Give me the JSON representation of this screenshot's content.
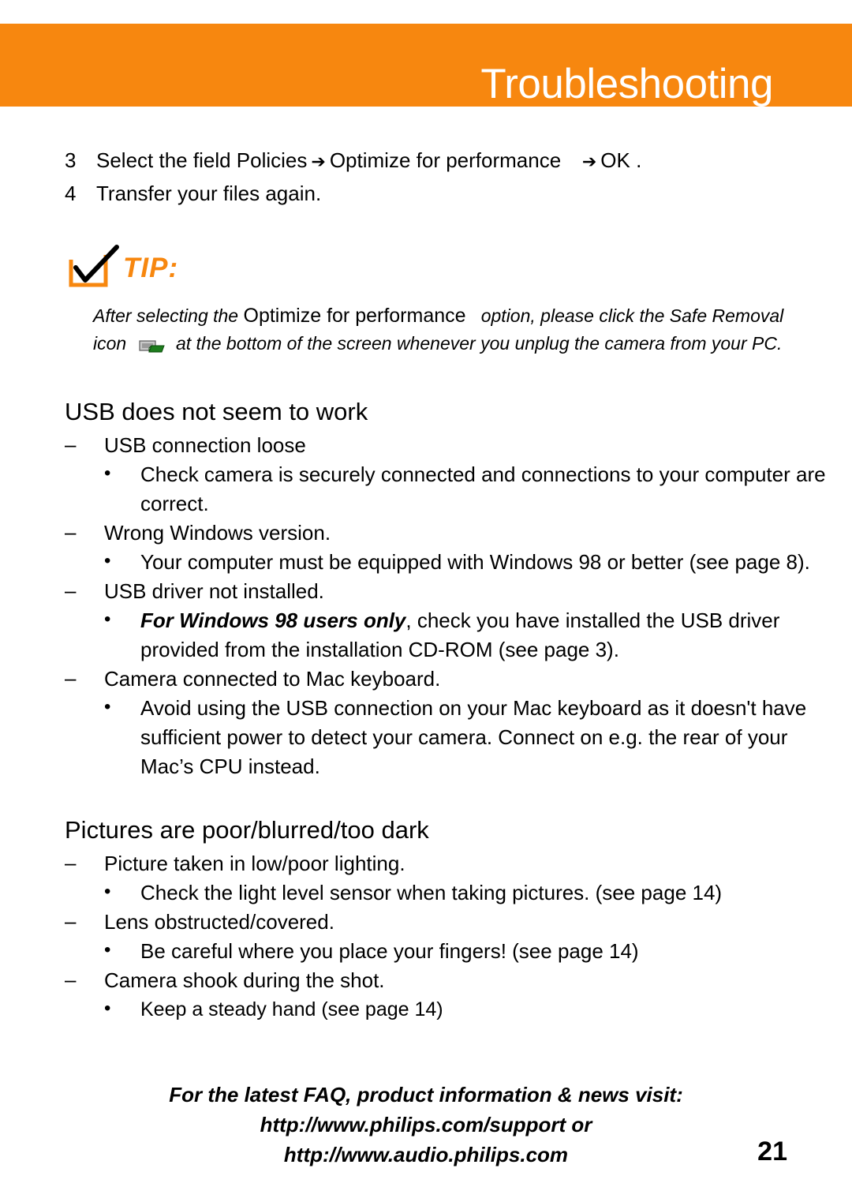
{
  "header": {
    "title": "Troubleshooting",
    "band_color": "#f7870f"
  },
  "steps": [
    {
      "num": "3",
      "part1": "Select the field",
      "emph1": "Policies",
      "arrow1": "➔",
      "emph2": "Optimize for performance",
      "arrow2": "➔",
      "emph3": "OK",
      "end": "."
    },
    {
      "num": "4",
      "text": "Transfer your files again."
    }
  ],
  "tip": {
    "label": "TIP:",
    "icon": "check-mark-icon",
    "line1_pre": "After selecting the",
    "line1_emph": "Optimize for performance",
    "line1_post": "option, please click the Safe Removal",
    "line2_pre": "icon",
    "line2_post": "at the bottom of the screen whenever you unplug the camera from your PC.",
    "safe_removal_icon": "safe-removal-icon"
  },
  "sections": [
    {
      "heading": "USB does not seem to work",
      "items": [
        {
          "type": "dash",
          "text": "USB connection loose"
        },
        {
          "type": "bullet",
          "text": "Check camera is securely connected and connections to your computer are correct."
        },
        {
          "type": "dash",
          "text": "Wrong Windows version."
        },
        {
          "type": "bullet",
          "text": "Your computer must be equipped with Windows 98 or better (see page 8)."
        },
        {
          "type": "dash",
          "text": "USB driver not installed."
        },
        {
          "type": "bullet",
          "bold": "For Windows 98 users only",
          "text": ", check you have installed the USB driver provided from the installation CD-ROM (see page 3)."
        },
        {
          "type": "dash",
          "text": "Camera connected to Mac keyboard."
        },
        {
          "type": "bullet",
          "text": "Avoid using the USB connection on your Mac keyboard as it doesn't have sufficient power to detect your camera. Connect on e.g. the rear of your Mac’s CPU instead."
        }
      ]
    },
    {
      "heading": "Pictures are poor/blurred/too dark",
      "items": [
        {
          "type": "dash",
          "text": "Picture taken in low/poor lighting."
        },
        {
          "type": "bullet",
          "text": "Check the light level sensor when taking pictures. (see page 14)"
        },
        {
          "type": "dash",
          "text": "Lens obstructed/covered."
        },
        {
          "type": "bullet",
          "text": "Be careful where you place your fingers! (see page 14)"
        },
        {
          "type": "dash",
          "text": "Camera shook during the shot."
        },
        {
          "type": "bullet",
          "text": "Keep a steady hand (see page 14)",
          "small": true
        }
      ]
    }
  ],
  "promo": {
    "line1": "For the latest FAQ, product information & news visit:",
    "line2": "http://www.philips.com/support or",
    "line3": "http://www.audio.philips.com"
  },
  "page_number": "21"
}
